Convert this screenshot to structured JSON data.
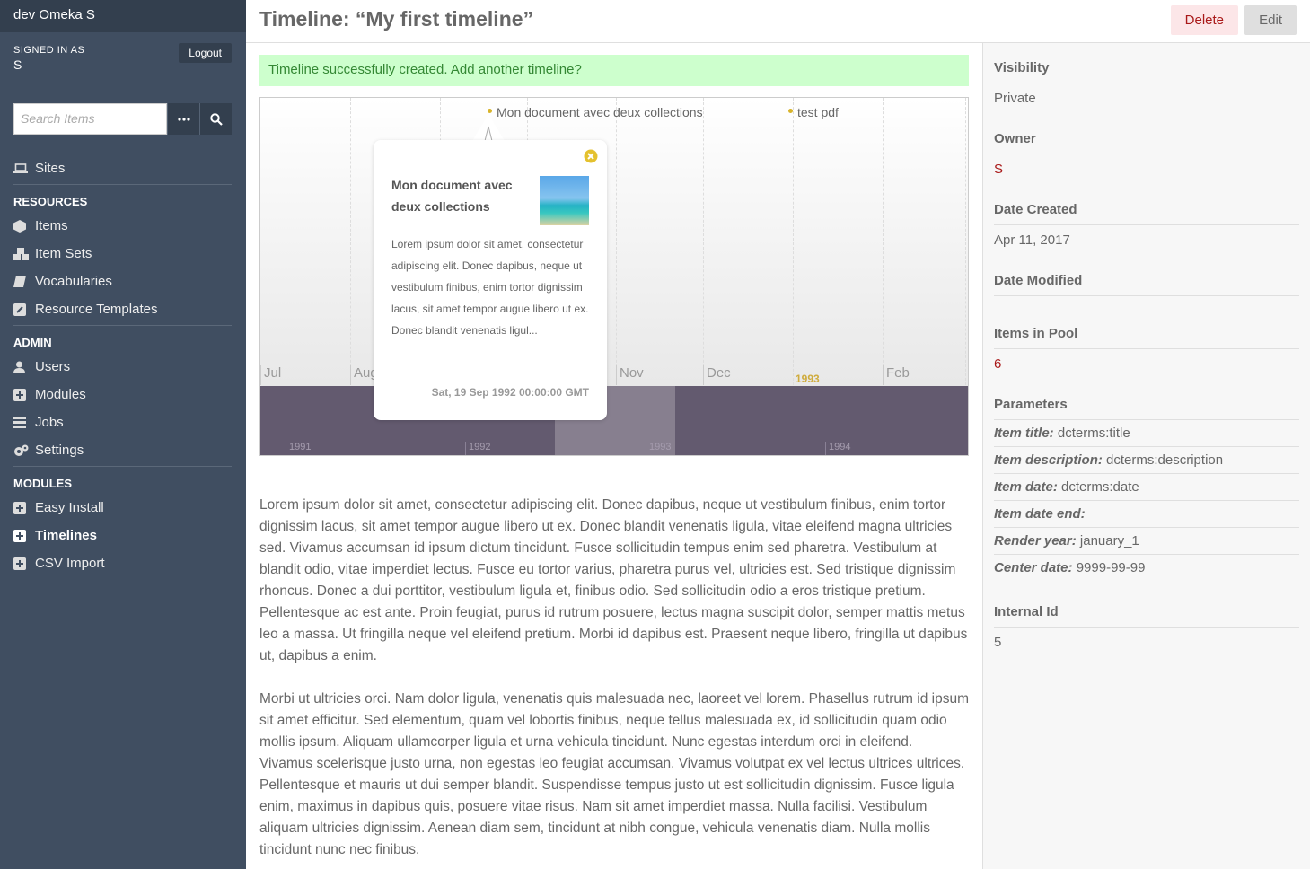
{
  "brand": "dev Omeka S",
  "user": {
    "signed_in_label": "Signed in as",
    "name": "S",
    "logout_label": "Logout"
  },
  "search": {
    "placeholder": "Search Items"
  },
  "nav": {
    "sites": "Sites",
    "resources_header": "Resources",
    "items": "Items",
    "item_sets": "Item Sets",
    "vocabularies": "Vocabularies",
    "resource_templates": "Resource Templates",
    "admin_header": "Admin",
    "users": "Users",
    "modules": "Modules",
    "jobs": "Jobs",
    "settings": "Settings",
    "modules_header": "Modules",
    "easy_install": "Easy Install",
    "timelines": "Timelines",
    "csv_import": "CSV Import"
  },
  "header": {
    "title": "Timeline: “My first timeline”",
    "delete_label": "Delete",
    "edit_label": "Edit"
  },
  "flash": {
    "message": "Timeline successfully created.",
    "link": "Add another timeline?"
  },
  "timeline": {
    "months": [
      "Jul",
      "Aug",
      "Nov",
      "Dec",
      "Feb"
    ],
    "year_marker": "1993",
    "events": [
      "Mon document avec deux collections",
      "test pdf"
    ],
    "years": [
      "1991",
      "1992",
      "1993",
      "1994"
    ],
    "bubble": {
      "title": "Mon document avec deux collections",
      "description": "Lorem ipsum dolor sit amet, consectetur adipiscing elit. Donec dapibus, neque ut vestibulum finibus, enim tortor dignissim lacus, sit amet tempor augue libero ut ex. Donec blandit venenatis ligul...",
      "date": "Sat, 19 Sep 1992 00:00:00 GMT"
    }
  },
  "body": {
    "p1": "Lorem ipsum dolor sit amet, consectetur adipiscing elit. Donec dapibus, neque ut vestibulum finibus, enim tortor dignissim lacus, sit amet tempor augue libero ut ex. Donec blandit venenatis ligula, vitae eleifend magna ultricies sed. Vivamus accumsan id ipsum dictum tincidunt. Fusce sollicitudin tempus enim sed pharetra. Vestibulum at blandit odio, vitae imperdiet lectus. Fusce eu tortor varius, pharetra purus vel, ultricies est. Sed tristique dignissim rhoncus. Donec a dui porttitor, vestibulum ligula et, finibus odio. Sed sollicitudin odio a eros tristique pretium. Pellentesque ac est ante. Proin feugiat, purus id rutrum posuere, lectus magna suscipit dolor, semper mattis metus leo a massa. Ut fringilla neque vel eleifend pretium. Morbi id dapibus est. Praesent neque libero, fringilla ut dapibus ut, dapibus a enim.",
    "p2": "Morbi ut ultricies orci. Nam dolor ligula, venenatis quis malesuada nec, laoreet vel lorem. Phasellus rutrum id ipsum sit amet efficitur. Sed elementum, quam vel lobortis finibus, neque tellus malesuada ex, id sollicitudin quam odio mollis ipsum. Aliquam ullamcorper ligula et urna vehicula tincidunt. Nunc egestas interdum orci in eleifend. Vivamus scelerisque justo urna, non egestas leo feugiat accumsan. Vivamus volutpat ex vel lectus ultrices ultrices. Pellentesque et mauris ut dui semper blandit. Suspendisse tempus justo ut est sollicitudin dignissim. Fusce ligula enim, maximus in dapibus quis, posuere vitae risus. Nam sit amet imperdiet massa. Nulla facilisi. Vestibulum aliquam ultricies dignissim. Aenean diam sem, tincidunt at nibh congue, vehicula venenatis diam. Nulla mollis tincidunt nunc nec finibus."
  },
  "panel": {
    "visibility_label": "Visibility",
    "visibility_value": "Private",
    "owner_label": "Owner",
    "owner_value": "S",
    "created_label": "Date Created",
    "created_value": "Apr 11, 2017",
    "modified_label": "Date Modified",
    "items_label": "Items in Pool",
    "items_value": "6",
    "params_label": "Parameters",
    "params": [
      {
        "key": "Item title:",
        "value": "dcterms:title"
      },
      {
        "key": "Item description:",
        "value": "dcterms:description"
      },
      {
        "key": "Item date:",
        "value": "dcterms:date"
      },
      {
        "key": "Item date end:",
        "value": ""
      },
      {
        "key": "Render year:",
        "value": "january_1"
      },
      {
        "key": "Center date:",
        "value": "9999-99-99"
      }
    ],
    "internal_label": "Internal Id",
    "internal_value": "5"
  },
  "colors": {
    "sidebar": "#404e61",
    "sidebar_dark": "#333f4e",
    "accent_red": "#a91919",
    "flash_bg": "#cdffcd",
    "event_gold": "#d8b42b"
  }
}
